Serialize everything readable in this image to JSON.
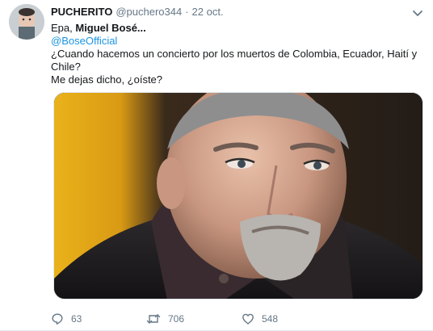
{
  "tweet": {
    "author_name": "PUCHERITO",
    "author_handle": "@puchero344",
    "separator": "·",
    "date": "22 oct.",
    "line1_prefix": "Epa, ",
    "line1_bold": "Miguel Bosé...",
    "mention": "@BoseOfficial",
    "line2": "¿Cuando hacemos un concierto por los muertos de Colombia, Ecuador, Haití y",
    "line3": "Chile?",
    "line4": "Me dejas dicho, ¿oíste?"
  },
  "actions": {
    "reply_count": "63",
    "retweet_count": "706",
    "like_count": "548"
  },
  "icons": {
    "avatar": "profile-photo",
    "caret": "chevron-down-icon",
    "reply": "reply-icon",
    "retweet": "retweet-icon",
    "like": "heart-icon"
  },
  "colors": {
    "mention": "#1b95e0",
    "secondary_text": "#657786",
    "primary_text": "#14171a"
  }
}
